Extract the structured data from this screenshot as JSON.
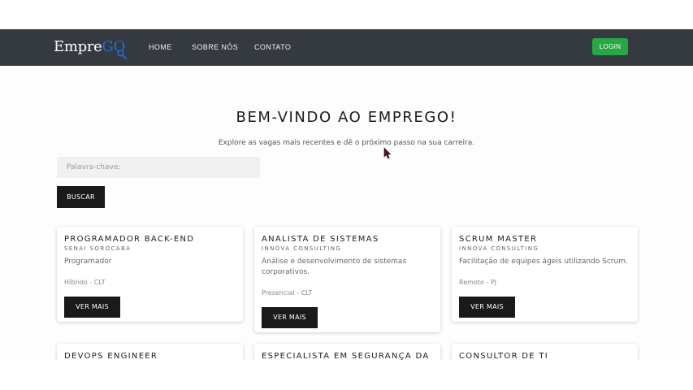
{
  "nav": {
    "brand_part1": "Empre",
    "brand_part2": "GO",
    "brand_icon": "magnifier-icon",
    "links": [
      "HOME",
      "SOBRE NÓS",
      "CONTATO"
    ],
    "login_label": "LOGIN"
  },
  "hero": {
    "title": "BEM-VINDO AO EMPREGO!",
    "subtitle": "Explore as vagas mais recentes e dê o próximo passo na sua carreira."
  },
  "search": {
    "placeholder": "Palavra-chave:",
    "value": "",
    "button_label": "BUSCAR"
  },
  "jobs": [
    {
      "title": "PROGRAMADOR BACK-END",
      "company": "SENAI SOROCABA",
      "description": "Programador",
      "meta": "Híbrido - CLT",
      "button": "VER MAIS"
    },
    {
      "title": "ANALISTA DE SISTEMAS",
      "company": "INNOVA CONSULTING",
      "description": "Análise e desenvolvimento de sistemas corporativos.",
      "meta": "Presencial - CLT",
      "button": "VER MAIS"
    },
    {
      "title": "SCRUM MASTER",
      "company": "INNOVA CONSULTING",
      "description": "Facilitação de equipes ágeis utilizando Scrum.",
      "meta": "Remoto - PJ",
      "button": "VER MAIS"
    },
    {
      "title": "DEVOPS ENGINEER"
    },
    {
      "title": "ESPECIALISTA EM SEGURANÇA DA"
    },
    {
      "title": "CONSULTOR DE TI"
    }
  ],
  "colors": {
    "navbar": "#343a40",
    "login": "#28a745",
    "brand_accent": "#1f6ed8",
    "button_dark": "#1a1a1a"
  }
}
